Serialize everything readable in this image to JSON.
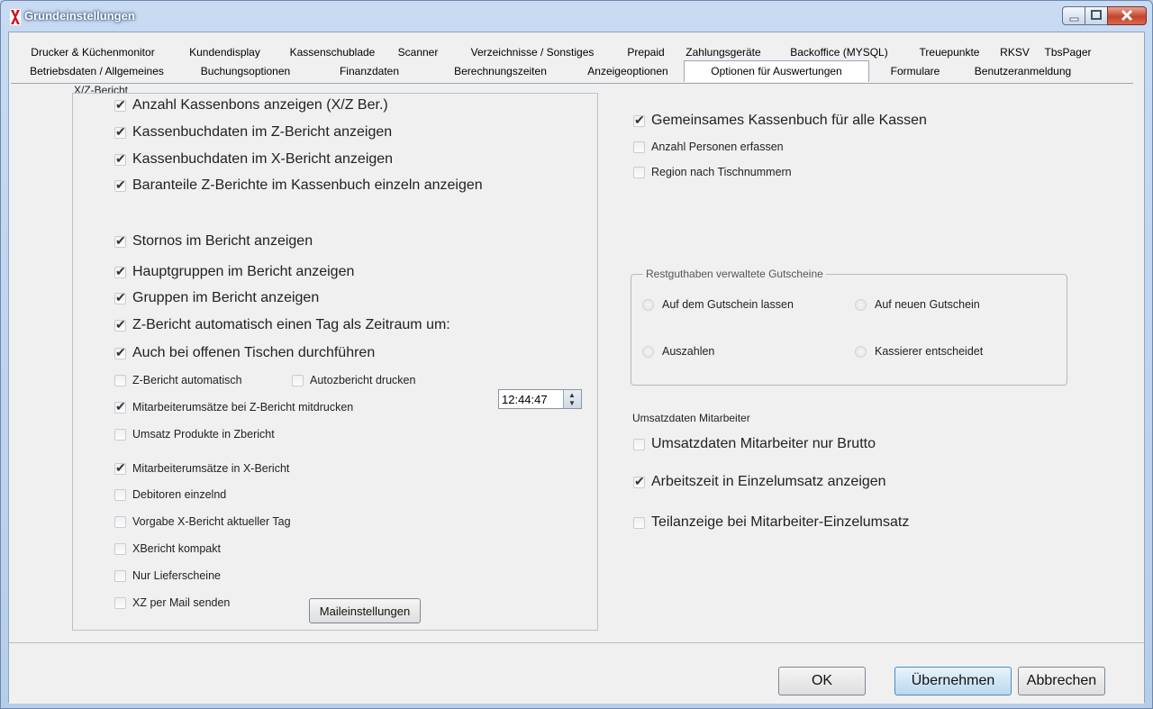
{
  "window": {
    "title": "Grundeinstellungen"
  },
  "tabs_row1": [
    "Drucker & Küchenmonitor",
    "Kundendisplay",
    "Kassenschublade",
    "Scanner",
    "Verzeichnisse / Sonstiges",
    "Prepaid",
    "Zahlungsgeräte",
    "Backoffice (MYSQL)",
    "Treuepunkte",
    "RKSV",
    "TbsPager"
  ],
  "tabs_row2": [
    "Betriebsdaten / Allgemeines",
    "Buchungsoptionen",
    "Finanzdaten",
    "Berechnungszeiten",
    "Anzeigeoptionen",
    "Optionen für Auswertungen",
    "Formulare",
    "Benutzeranmeldung"
  ],
  "active_tab": "Optionen für Auswertungen",
  "xz": {
    "label": "X/Z-Bericht",
    "items": [
      {
        "label": "Anzahl Kassenbons anzeigen (X/Z Ber.)",
        "checked": true
      },
      {
        "label": "Kassenbuchdaten im Z-Bericht anzeigen",
        "checked": true
      },
      {
        "label": "Kassenbuchdaten im X-Bericht anzeigen",
        "checked": true
      },
      {
        "label": "Baranteile Z-Berichte im Kassenbuch einzeln anzeigen",
        "checked": true
      },
      {
        "label": "Stornos im Bericht anzeigen",
        "checked": true
      },
      {
        "label": "Hauptgruppen im Bericht anzeigen",
        "checked": true
      },
      {
        "label": "Gruppen im Bericht anzeigen",
        "checked": true
      },
      {
        "label": "Z-Bericht automatisch einen Tag als Zeitraum um:",
        "checked": true
      },
      {
        "label": "Auch bei offenen Tischen durchführen",
        "checked": true
      },
      {
        "label": "Z-Bericht automatisch",
        "checked": false
      },
      {
        "label": "Autozbericht drucken",
        "checked": false
      },
      {
        "label": "Mitarbeiterumsätze bei  Z-Bericht mitdrucken",
        "checked": true
      },
      {
        "label": "Umsatz Produkte in Zbericht",
        "checked": false
      },
      {
        "label": "Mitarbeiterumsätze in X-Bericht",
        "checked": true
      },
      {
        "label": "Debitoren einzelnd",
        "checked": false
      },
      {
        "label": "Vorgabe X-Bericht aktueller Tag",
        "checked": false
      },
      {
        "label": "XBericht kompakt",
        "checked": false
      },
      {
        "label": "Nur Lieferscheine",
        "checked": false
      },
      {
        "label": "XZ per Mail senden",
        "checked": false
      }
    ],
    "time_value": "12:44:47",
    "mail_button": "Maileinstellungen"
  },
  "right": {
    "items": [
      {
        "label": "Gemeinsames Kassenbuch für alle Kassen",
        "checked": true
      },
      {
        "label": "Anzahl Personen erfassen",
        "checked": false
      },
      {
        "label": "Region nach Tischnummern",
        "checked": false
      }
    ],
    "voucher_group": {
      "label": "Restguthaben verwaltete Gutscheine",
      "options": [
        "Auf dem Gutschein lassen",
        "Auf neuen Gutschein",
        "Auszahlen",
        "Kassierer entscheidet"
      ]
    },
    "employee_label": "Umsatzdaten Mitarbeiter",
    "employee_items": [
      {
        "label": "Umsatzdaten Mitarbeiter nur Brutto",
        "checked": false
      },
      {
        "label": "Arbeitszeit in Einzelumsatz anzeigen",
        "checked": true
      },
      {
        "label": "Teilanzeige bei Mitarbeiter-Einzelumsatz",
        "checked": false
      }
    ]
  },
  "buttons": {
    "ok": "OK",
    "apply": "Übernehmen",
    "cancel": "Abbrechen"
  },
  "colors": {
    "title_text": "#ffffff",
    "frame": "#b7c3d0",
    "apply_button": "#b9d9ef"
  }
}
